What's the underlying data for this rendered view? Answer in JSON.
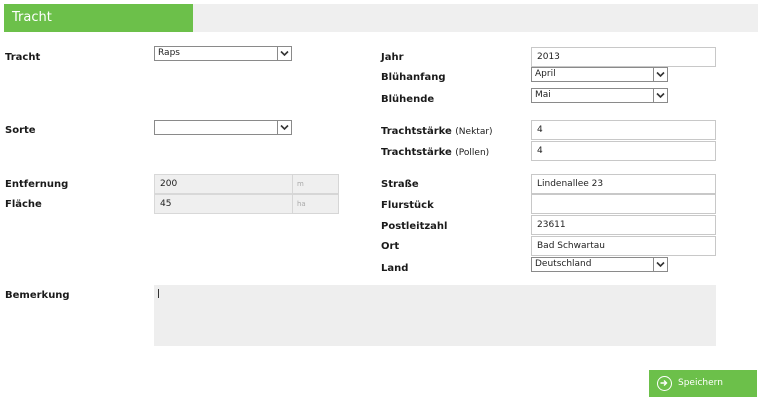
{
  "header": {
    "title": "Tracht"
  },
  "left": {
    "tracht": {
      "label": "Tracht",
      "value": "Raps"
    },
    "sorte": {
      "label": "Sorte",
      "value": ""
    },
    "entfernung": {
      "label": "Entfernung",
      "value": "200",
      "unit": "m"
    },
    "flaeche": {
      "label": "Fläche",
      "value": "45",
      "unit": "ha"
    },
    "bemerkung": {
      "label": "Bemerkung",
      "value": ""
    }
  },
  "right": {
    "jahr": {
      "label": "Jahr",
      "value": "2013"
    },
    "bluehanfang": {
      "label": "Blühanfang",
      "value": "April"
    },
    "bluehende": {
      "label": "Blühende",
      "value": "Mai"
    },
    "trachtstaerke_nektar": {
      "label": "Trachtstärke",
      "sub": "(Nektar)",
      "value": "4"
    },
    "trachtstaerke_pollen": {
      "label": "Trachtstärke",
      "sub": "(Pollen)",
      "value": "4"
    },
    "strasse": {
      "label": "Straße",
      "value": "Lindenallee 23"
    },
    "flurstueck": {
      "label": "Flurstück",
      "value": ""
    },
    "postleitzahl": {
      "label": "Postleitzahl",
      "value": "23611"
    },
    "ort": {
      "label": "Ort",
      "value": "Bad Schwartau"
    },
    "land": {
      "label": "Land",
      "value": "Deutschland"
    }
  },
  "actions": {
    "save_label": "Speichern"
  },
  "colors": {
    "accent": "#6cc04a",
    "header_bg": "#efefef",
    "field_disabled": "#efefef"
  },
  "icons": {
    "select_arrow": "chevron-down-icon",
    "save": "arrow-right-circle-icon"
  }
}
